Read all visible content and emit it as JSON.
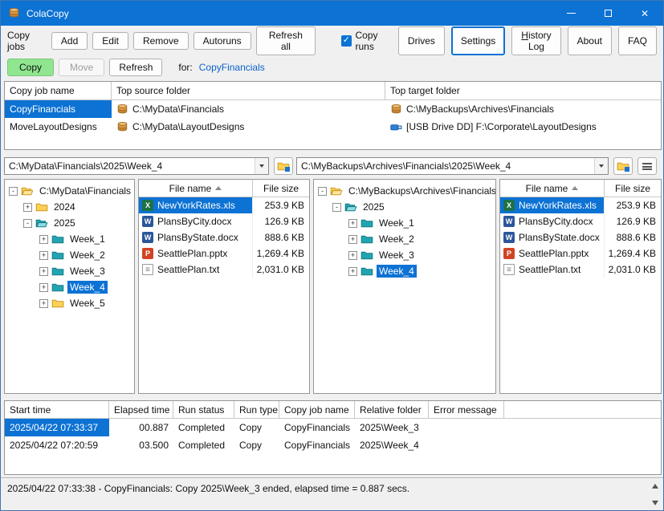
{
  "window": {
    "title": "ColaCopy"
  },
  "icons": {
    "close": "✕",
    "check": "✓",
    "app": "colacopy-logo",
    "minimize": "bar",
    "maximize": "square",
    "combo_dropdown": "down-triangle",
    "browse_folder": "folder-with-blue-corner",
    "view_options": "hamburger",
    "sort_ascending": "up-triangle",
    "scroll_up": "up-triangle",
    "scroll_down": "down-triangle",
    "local_drive": "disk-stack",
    "usb_drive": "usb-drive"
  },
  "toolbar": {
    "copy_jobs_label": "Copy jobs",
    "add": "Add",
    "edit": "Edit",
    "remove": "Remove",
    "autoruns": "Autoruns",
    "refresh_all": "Refresh all",
    "copy_runs_label": "Copy runs",
    "copy_runs_checked": true,
    "drives": "Drives",
    "settings": "Settings",
    "settings_active": true,
    "history_log_key": "H",
    "history_log_rest": "istory Log",
    "about": "About",
    "faq": "FAQ"
  },
  "actionbar": {
    "copy": "Copy",
    "move": "Move",
    "move_enabled": false,
    "refresh": "Refresh",
    "for_label": "for:",
    "current_job": "CopyFinancials"
  },
  "jobs_table": {
    "columns": [
      "Copy job name",
      "Top source folder",
      "Top target folder"
    ],
    "rows": [
      {
        "name": "CopyFinancials",
        "source": "C:\\MyData\\Financials",
        "source_icon": "disk-stack",
        "target": "C:\\MyBackups\\Archives\\Financials",
        "target_icon": "disk-stack",
        "selected": true
      },
      {
        "name": "MoveLayoutDesigns",
        "source": "C:\\MyData\\LayoutDesigns",
        "source_icon": "disk-stack",
        "target": "[USB Drive DD] F:\\Corporate\\LayoutDesigns",
        "target_icon": "usb-drive",
        "selected": false
      }
    ]
  },
  "source_pane": {
    "path": "C:\\MyData\\Financials\\2025\\Week_4",
    "tree": [
      {
        "label": "C:\\MyData\\Financials",
        "level": 0,
        "expander": "-",
        "icon": "folder-open-yellow",
        "selected": false
      },
      {
        "label": "2024",
        "level": 1,
        "expander": "+",
        "icon": "folder-yellow",
        "selected": false
      },
      {
        "label": "2025",
        "level": 1,
        "expander": "-",
        "icon": "folder-open-teal",
        "selected": false
      },
      {
        "label": "Week_1",
        "level": 2,
        "expander": "+",
        "icon": "folder-teal",
        "selected": false
      },
      {
        "label": "Week_2",
        "level": 2,
        "expander": "+",
        "icon": "folder-teal",
        "selected": false
      },
      {
        "label": "Week_3",
        "level": 2,
        "expander": "+",
        "icon": "folder-teal",
        "selected": false
      },
      {
        "label": "Week_4",
        "level": 2,
        "expander": "+",
        "icon": "folder-teal",
        "selected": true
      },
      {
        "label": "Week_5",
        "level": 2,
        "expander": "+",
        "icon": "folder-yellow",
        "selected": false
      }
    ],
    "files": {
      "columns": [
        "File name",
        "File size"
      ],
      "sort": "ascending",
      "rows": [
        {
          "icon": "excel",
          "name": "NewYorkRates.xls",
          "size": "253.9 KB",
          "selected": true
        },
        {
          "icon": "word",
          "name": "PlansByCity.docx",
          "size": "126.9 KB",
          "selected": false
        },
        {
          "icon": "word",
          "name": "PlansByState.docx",
          "size": "888.6 KB",
          "selected": false
        },
        {
          "icon": "powerpoint",
          "name": "SeattlePlan.pptx",
          "size": "1,269.4 KB",
          "selected": false
        },
        {
          "icon": "text",
          "name": "SeattlePlan.txt",
          "size": "2,031.0 KB",
          "selected": false
        }
      ]
    }
  },
  "target_pane": {
    "path": "C:\\MyBackups\\Archives\\Financials\\2025\\Week_4",
    "tree": [
      {
        "label": "C:\\MyBackups\\Archives\\Financials",
        "level": 0,
        "expander": "-",
        "icon": "folder-open-yellow",
        "selected": false
      },
      {
        "label": "2025",
        "level": 1,
        "expander": "-",
        "icon": "folder-open-teal",
        "selected": false
      },
      {
        "label": "Week_1",
        "level": 2,
        "expander": "+",
        "icon": "folder-teal",
        "selected": false
      },
      {
        "label": "Week_2",
        "level": 2,
        "expander": "+",
        "icon": "folder-teal",
        "selected": false
      },
      {
        "label": "Week_3",
        "level": 2,
        "expander": "+",
        "icon": "folder-teal",
        "selected": false
      },
      {
        "label": "Week_4",
        "level": 2,
        "expander": "+",
        "icon": "folder-teal",
        "selected": true
      }
    ],
    "files": {
      "columns": [
        "File name",
        "File size"
      ],
      "sort": "ascending",
      "rows": [
        {
          "icon": "excel",
          "name": "NewYorkRates.xls",
          "size": "253.9 KB",
          "selected": true
        },
        {
          "icon": "word",
          "name": "PlansByCity.docx",
          "size": "126.9 KB",
          "selected": false
        },
        {
          "icon": "word",
          "name": "PlansByState.docx",
          "size": "888.6 KB",
          "selected": false
        },
        {
          "icon": "powerpoint",
          "name": "SeattlePlan.pptx",
          "size": "1,269.4 KB",
          "selected": false
        },
        {
          "icon": "text",
          "name": "SeattlePlan.txt",
          "size": "2,031.0 KB",
          "selected": false
        }
      ]
    }
  },
  "history_table": {
    "columns": [
      "Start time",
      "Elapsed time",
      "Run status",
      "Run type",
      "Copy job name",
      "Relative folder",
      "Error message"
    ],
    "rows": [
      {
        "start_time": "2025/04/22 07:33:37",
        "elapsed": "00.887",
        "status": "Completed",
        "run_type": "Copy",
        "job": "CopyFinancials",
        "folder": "2025\\Week_3",
        "error": "",
        "selected": true
      },
      {
        "start_time": "2025/04/22 07:20:59",
        "elapsed": "03.500",
        "status": "Completed",
        "run_type": "Copy",
        "job": "CopyFinancials",
        "folder": "2025\\Week_4",
        "error": "",
        "selected": false
      }
    ]
  },
  "status_bar": {
    "message": "2025/04/22 07:33:38 - CopyFinancials: Copy 2025\\Week_3 ended, elapsed time = 0.887 secs."
  }
}
